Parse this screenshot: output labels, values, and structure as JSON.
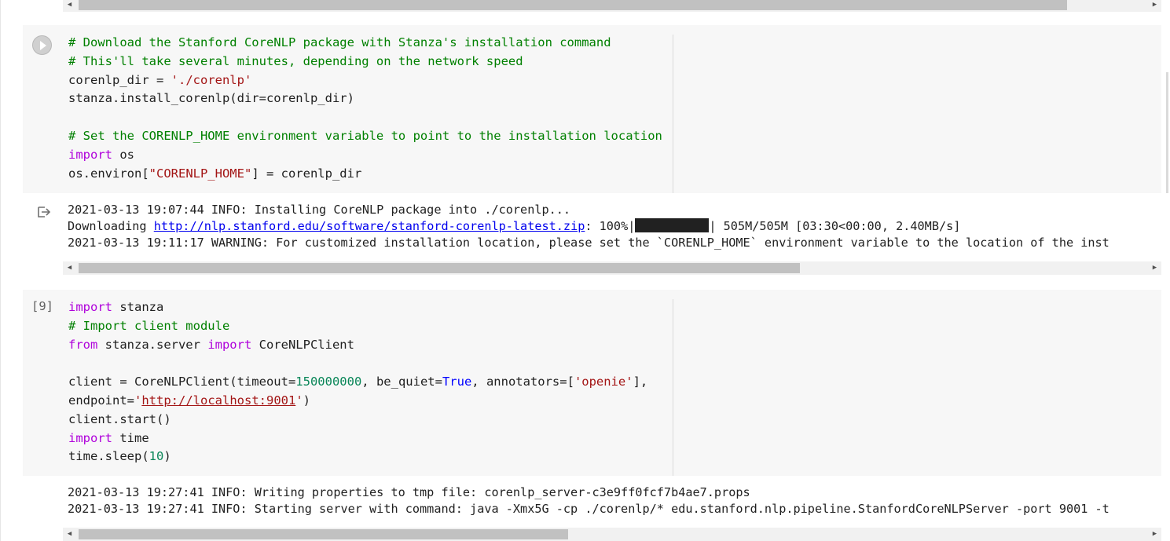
{
  "top_output": {
    "scrollbar": {
      "left_arrow": "◀",
      "right_arrow": "▶"
    }
  },
  "cell1": {
    "run_icon": "play-circle-icon",
    "code_lines": [
      "# Download the Stanford CoreNLP package with Stanza's installation command",
      "# This'll take several minutes, depending on the network speed",
      "corenlp_dir = './corenlp'",
      "stanza.install_corenlp(dir=corenlp_dir)",
      "",
      "# Set the CORENLP_HOME environment variable to point to the installation location",
      "import os",
      "os.environ[\"CORENLP_HOME\"] = corenlp_dir"
    ],
    "output_icon": "output-redirect-icon",
    "output": {
      "line1": "2021-03-13 19:07:44 INFO: Installing CoreNLP package into ./corenlp...",
      "download_prefix": "Downloading ",
      "download_url": "http://nlp.stanford.edu/software/stanford-corenlp-latest.zip",
      "download_percent": ": 100%|",
      "download_suffix": "| 505M/505M [03:30<00:00, 2.40MB/s]",
      "progress_fraction": 1.0,
      "line3": "2021-03-13 19:11:17 WARNING: For customized installation location, please set the `CORENLP_HOME` environment variable to the location of the inst"
    }
  },
  "cell2": {
    "execution_count": "[9]",
    "code_lines": [
      "import stanza",
      "# Import client module",
      "from stanza.server import CoreNLPClient",
      "",
      "client = CoreNLPClient(timeout=150000000, be_quiet=True, annotators=['openie'],",
      "endpoint='http://localhost:9001')",
      "client.start()",
      "import time",
      "time.sleep(10)"
    ],
    "output": {
      "line1": "2021-03-13 19:27:41 INFO: Writing properties to tmp file: corenlp_server-c3e9ff0fcf7b4ae7.props",
      "line2": "2021-03-13 19:27:41 INFO: Starting server with command: java -Xmx5G -cp ./corenlp/* edu.stanford.nlp.pipeline.StanfordCoreNLPServer -port 9001 -t"
    }
  },
  "colors": {
    "cell_background": "#f7f7f7",
    "comment": "#008000",
    "string": "#a31515",
    "keyword": "#af00db",
    "number": "#098658",
    "boolean": "#0000ff",
    "link": "#0000ee"
  }
}
